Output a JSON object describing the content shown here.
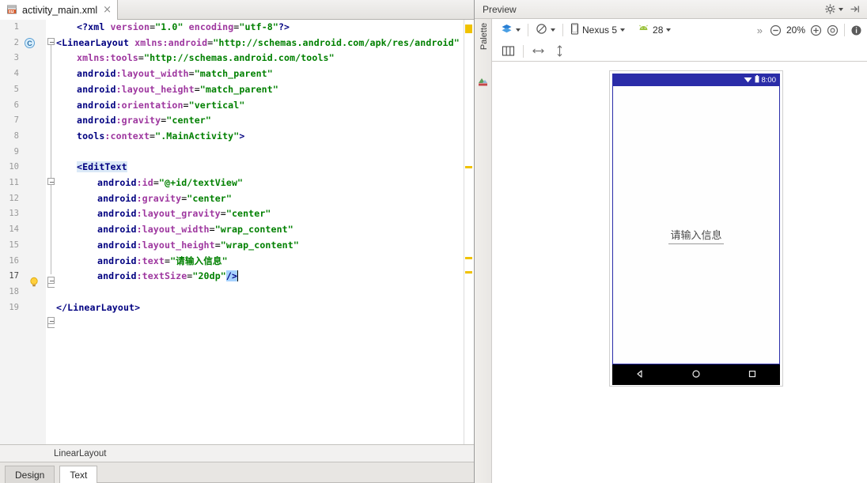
{
  "window": {
    "editor_tab": {
      "filename": "activity_main.xml",
      "icon": "xml-file-icon",
      "close": "×"
    },
    "preview_title": "Preview"
  },
  "editor": {
    "breadcrumb": "LinearLayout",
    "bottom_tabs": [
      {
        "label": "Design",
        "active": false
      },
      {
        "label": "Text",
        "active": true
      }
    ],
    "gutter_badge": "C",
    "line_numbers": [
      "1",
      "2",
      "3",
      "4",
      "5",
      "6",
      "7",
      "8",
      "9",
      "10",
      "11",
      "12",
      "13",
      "14",
      "15",
      "16",
      "17",
      "18",
      "19"
    ],
    "code": {
      "l1": "<?xml version=\"1.0\" encoding=\"utf-8\"?>",
      "l2": "<LinearLayout xmlns:android=\"http://schemas.android.com/apk/res/android\"",
      "l3": "xmlns:tools=\"http://schemas.android.com/tools\"",
      "l4": "android:layout_width=\"match_parent\"",
      "l5": "android:layout_height=\"match_parent\"",
      "l6": "android:orientation=\"vertical\"",
      "l7": "android:gravity=\"center\"",
      "l8": "tools:context=\".MainActivity\">",
      "l9": "",
      "l10": "<EditText",
      "l11": "android:id=\"@+id/textView\"",
      "l12": "android:gravity=\"center\"",
      "l13": "android:layout_gravity=\"center\"",
      "l14": "android:layout_width=\"wrap_content\"",
      "l15": "android:layout_height=\"wrap_content\"",
      "l16": "android:text=\"请输入信息\"",
      "l17": "android:textSize=\"20dp\"/>",
      "l18": "",
      "l19": "</LinearLayout>"
    },
    "tokens": {
      "xml_decl_open": "<?xml",
      "xml_decl_close": "?>",
      "attr_version": "version",
      "val_version": "\"1.0\"",
      "attr_encoding": "encoding",
      "val_encoding": "\"utf-8\"",
      "tag_linearlayout_open": "<LinearLayout",
      "tag_linearlayout_close": "</LinearLayout>",
      "tag_edittext": "<EditText",
      "ns_xmlns_android": "xmlns:android",
      "val_android_ns": "\"http://schemas.android.com/apk/res/android\"",
      "ns_xmlns_tools": "xmlns:tools",
      "val_tools_ns": "\"http://schemas.android.com/tools\"",
      "ns_android": "android",
      "ns_tools": "tools",
      "attr_layout_width": ":layout_width",
      "attr_layout_height": ":layout_height",
      "attr_orientation": ":orientation",
      "attr_gravity": ":gravity",
      "attr_layout_gravity": ":layout_gravity",
      "attr_context": ":context",
      "attr_id": ":id",
      "attr_text": ":text",
      "attr_textsize": ":textSize",
      "val_match_parent": "\"match_parent\"",
      "val_vertical": "\"vertical\"",
      "val_center": "\"center\"",
      "val_wrap_content": "\"wrap_content\"",
      "val_mainactivity": "\".MainActivity\"",
      "val_textview_id": "\"@+id/textView\"",
      "val_chinese_text": "\"请输入信息\"",
      "val_textsize": "\"20dp\"",
      "eq": "=",
      "gt": ">",
      "selfclose": "/>"
    }
  },
  "preview": {
    "palette_label": "Palette",
    "toolbar": {
      "layers_icon": "layers-icon",
      "orientation_icon": "orientation-icon",
      "device_icon": "phone-icon",
      "device_name": "Nexus 5",
      "api_icon": "android-icon",
      "api_level": "28",
      "overflow": "»",
      "zoom_out_icon": "zoom-out-icon",
      "zoom_level": "20%",
      "zoom_in_icon": "zoom-in-icon",
      "zoom_fit_icon": "zoom-fit-icon",
      "info_icon": "info-icon",
      "gear_icon": "gear-icon",
      "collapse_icon": "collapse-icon",
      "grid_icon": "grid-icon",
      "width_icon": "horizontal-resize-icon",
      "height_icon": "vertical-resize-icon"
    },
    "device_screen": {
      "status_time": "8:00",
      "wifi_icon": "wifi-icon",
      "battery_icon": "battery-icon",
      "edittext_value": "请输入信息",
      "nav_back_icon": "nav-back-icon",
      "nav_home_icon": "nav-home-icon",
      "nav_recents_icon": "nav-recents-icon"
    }
  },
  "colors": {
    "status_bar": "#2a2ca8",
    "tag": "#000080",
    "attribute": "#9e379f",
    "string": "#008000",
    "highlight_row": "#fdf8e3",
    "selection": "#a6d2ff",
    "marker": "#f0c200"
  }
}
